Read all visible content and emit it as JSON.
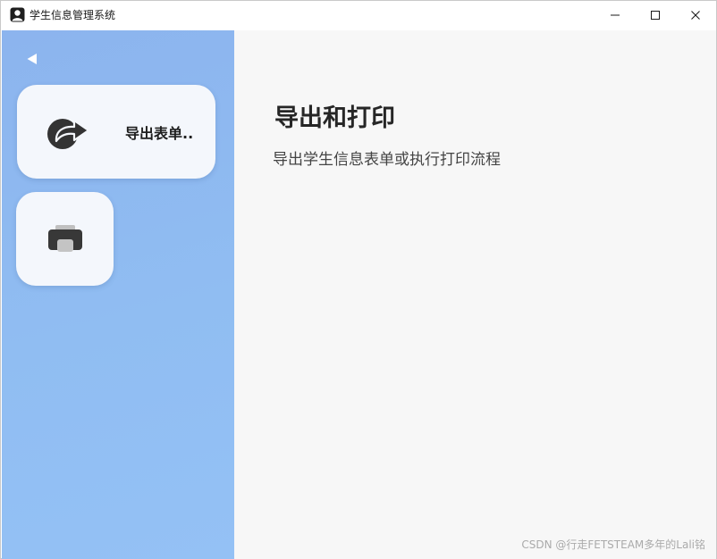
{
  "window": {
    "title": "学生信息管理系统",
    "controls": [
      "minimize",
      "maximize",
      "close"
    ]
  },
  "sidebar": {
    "back_icon": "back-triangle-icon",
    "items": [
      {
        "label": "导出表单..",
        "icon": "share-arrow-icon",
        "active": true
      },
      {
        "label": "",
        "icon": "printer-icon",
        "active": false
      }
    ]
  },
  "main": {
    "title": "导出和打印",
    "subtitle": "导出学生信息表单或执行打印流程"
  },
  "watermark": "CSDN @行走FETSTEAM多年的Lali铭",
  "colors": {
    "sidebar_gradient_start": "#8cb4ee",
    "sidebar_gradient_end": "#94c1f5",
    "card_background": "#f4f7fc",
    "content_background": "#f7f7f7",
    "icon_dark": "#333333"
  }
}
